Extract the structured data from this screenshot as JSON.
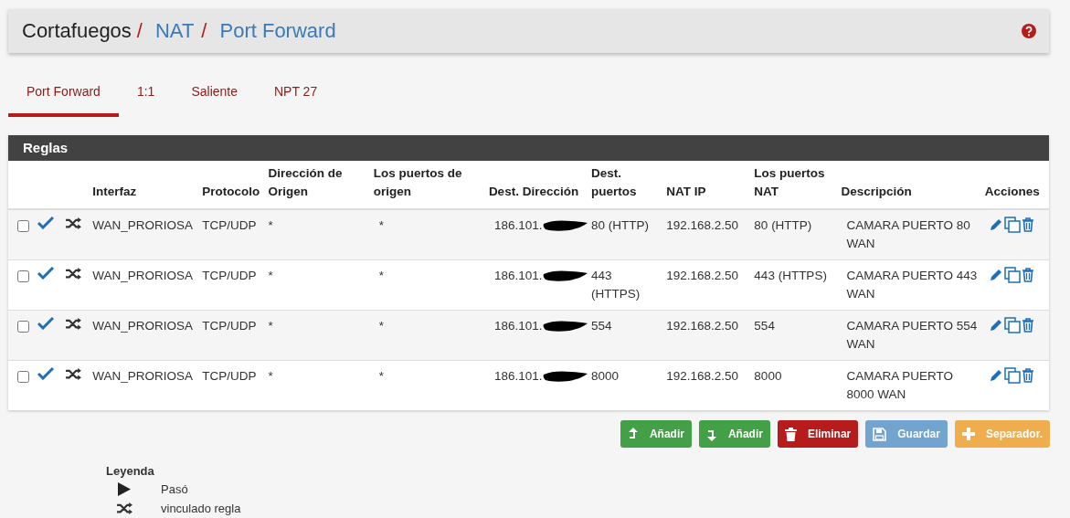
{
  "breadcrumb": [
    {
      "label": "Cortafuegos",
      "kind": "plain",
      "separator": "/"
    },
    {
      "label": "NAT",
      "kind": "link",
      "separator": "/"
    },
    {
      "label": "Port Forward",
      "kind": "link"
    }
  ],
  "tabs": [
    {
      "label": "Port Forward",
      "selected": true
    },
    {
      "label": "1:1",
      "selected": false
    },
    {
      "label": "Saliente",
      "selected": false
    },
    {
      "label": "NPT 27",
      "selected": false
    }
  ],
  "panel": {
    "title": "Reglas",
    "columns": [
      "",
      "",
      "",
      "Interfaz",
      "Protocolo",
      "Dirección de Origen",
      "Los puertos de origen",
      "Dest. Dirección",
      "Dest. puertos",
      "NAT IP",
      "Los puertos NAT",
      "Descripción",
      "Acciones"
    ],
    "rows": [
      {
        "checked": false,
        "enabled": true,
        "interface": "WAN_PRORIOSA",
        "protocol": "TCP/UDP",
        "source": "*",
        "source_ports": "*",
        "dest": "186.101.",
        "dest_ports": "80 (HTTP)",
        "nat_ip": "192.168.2.50",
        "nat_ports": "80 (HTTP)",
        "description": "CAMARA PUERTO 80 WAN"
      },
      {
        "checked": false,
        "enabled": true,
        "interface": "WAN_PRORIOSA",
        "protocol": "TCP/UDP",
        "source": "*",
        "source_ports": "*",
        "dest": "186.101.",
        "dest_ports": "443 (HTTPS)",
        "nat_ip": "192.168.2.50",
        "nat_ports": "443 (HTTPS)",
        "description": "CAMARA PUERTO 443 WAN"
      },
      {
        "checked": false,
        "enabled": true,
        "interface": "WAN_PRORIOSA",
        "protocol": "TCP/UDP",
        "source": "*",
        "source_ports": "*",
        "dest": "186.101.",
        "dest_ports": "554",
        "nat_ip": "192.168.2.50",
        "nat_ports": "554",
        "description": "CAMARA PUERTO 554 WAN"
      },
      {
        "checked": false,
        "enabled": true,
        "interface": "WAN_PRORIOSA",
        "protocol": "TCP/UDP",
        "source": "*",
        "source_ports": "*",
        "dest": "186.101.",
        "dest_ports": "8000",
        "nat_ip": "192.168.2.50",
        "nat_ports": "8000",
        "description": "CAMARA PUERTO 8000 WAN"
      }
    ]
  },
  "buttons": [
    {
      "label": "Añadir",
      "kind": "add-top",
      "disabled": false
    },
    {
      "label": "Añadir",
      "kind": "add-bottom",
      "disabled": false
    },
    {
      "label": "Eliminar",
      "kind": "delete",
      "disabled": false
    },
    {
      "label": "Guardar",
      "kind": "save",
      "disabled": true
    },
    {
      "label": "Separador.",
      "kind": "separator",
      "disabled": false
    }
  ],
  "legend": {
    "title": "Leyenda",
    "items": [
      {
        "kind": "pass",
        "label": "Pasó"
      },
      {
        "kind": "linked",
        "label": "vinculado regla"
      }
    ]
  }
}
